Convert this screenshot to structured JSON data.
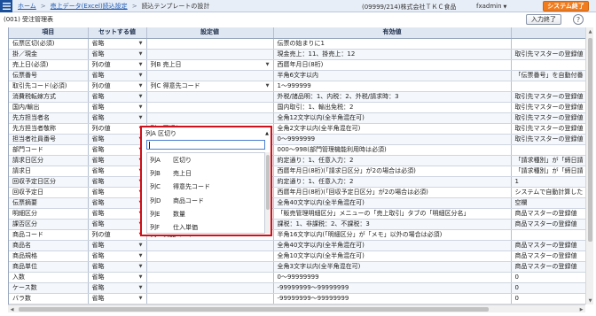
{
  "topbar": {
    "breadcrumbs": [
      "ホーム",
      "売上データ(Excel)読込設定",
      "読込テンプレートの設計"
    ],
    "company": "(09999/214)株式会社ＴＫＣ食品",
    "user": "fxadmin",
    "exit_label": "システム終了",
    "accent_color": "#f07c1e"
  },
  "subbar": {
    "screen_id": "(001) 受注管理表",
    "end_input_label": "入力終了",
    "help_label": "?"
  },
  "table": {
    "headers": [
      "項目",
      "セットする値",
      "設定値",
      "有効値",
      ""
    ],
    "rows": [
      {
        "item": "伝票区切(必須)",
        "set": "省略",
        "setting": "",
        "valid": "伝票の始まりに1",
        "extra": ""
      },
      {
        "item": "掛／現金",
        "set": "省略",
        "setting": "",
        "valid": "現金売上：11、掛売上：12",
        "extra": "取引先マスターの登録値"
      },
      {
        "item": "売上日(必須)",
        "set": "列の値",
        "setting": "列B 売上日",
        "valid": "西暦年月日(8桁)",
        "extra": ""
      },
      {
        "item": "伝票番号",
        "set": "省略",
        "setting": "",
        "valid": "半角6文字以内",
        "extra": "「伝票番号」を自動付番"
      },
      {
        "item": "取引先コード(必須)",
        "set": "列の値",
        "setting": "列C 得意先コード",
        "valid": "1～999999",
        "extra": ""
      },
      {
        "item": "消費税転嫁方式",
        "set": "省略",
        "setting": "",
        "valid": "外税/諸品明：1、内税：2、外税/請求時：3",
        "extra": "取引先マスターの登録値"
      },
      {
        "item": "国内/輸出",
        "set": "省略",
        "setting": "",
        "valid": "国内取引：1、輸出免税：2",
        "extra": "取引先マスターの登録値"
      },
      {
        "item": "先方担当者名",
        "set": "省略",
        "setting": "",
        "valid": "全角12文字以内(全半角混在可)",
        "extra": "取引先マスターの登録値"
      },
      {
        "item": "先方担当者敬称",
        "set": "列の値",
        "setting": "列A 区切り",
        "valid": "全角2文字以内(全半角混在可)",
        "extra": "取引先マスターの登録値"
      },
      {
        "item": "担当者社員番号",
        "set": "省略",
        "setting": "",
        "valid": "0～9999999",
        "extra": "取引先マスターの登録値"
      },
      {
        "item": "部門コード",
        "set": "省略",
        "setting": "",
        "valid": "000～998(部門管理機能利用時は必須)",
        "extra": ""
      },
      {
        "item": "請求日区分",
        "set": "省略",
        "setting": "",
        "valid": "約定通り：1、任意入力：2",
        "extra": "「請求種別」が「締日請"
      },
      {
        "item": "請求日",
        "set": "省略",
        "setting": "",
        "valid": "西暦年月日(8桁)(「請求日区分」が2の場合は必須)",
        "extra": "「請求種別」が「締日請"
      },
      {
        "item": "回収予定日区分",
        "set": "省略",
        "setting": "",
        "valid": "約定通り：1、任意入力：2",
        "extra": "1"
      },
      {
        "item": "回収予定日",
        "set": "省略",
        "setting": "",
        "valid": "西暦年月日(8桁)(「回収予定日区分」が2の場合は必須)",
        "extra": "システムで自動計算した"
      },
      {
        "item": "伝票摘要",
        "set": "省略",
        "setting": "",
        "valid": "全角40文字以内(全半角混在可)",
        "extra": "空欄"
      },
      {
        "item": "明細区分",
        "set": "省略",
        "setting": "",
        "valid": "「販売管理明細区分」メニューの「売上取引」タブの「明細区分名」",
        "extra": "商品マスターの登録値"
      },
      {
        "item": "課否区分",
        "set": "省略",
        "setting": "",
        "valid": "課税：1、非課税：2、不課税：3",
        "extra": "商品マスターの登録値"
      },
      {
        "item": "商品コード",
        "set": "列の値",
        "setting": "列D 商品コード",
        "valid": "半角16文字以内(「明細区分」が「メモ」以外の場合は必須)",
        "extra": ""
      },
      {
        "item": "商品名",
        "set": "省略",
        "setting": "",
        "valid": "全角40文字以内(全半角混在可)",
        "extra": "商品マスターの登録値"
      },
      {
        "item": "商品規格",
        "set": "省略",
        "setting": "",
        "valid": "全角10文字以内(全半角混在可)",
        "extra": "商品マスターの登録値"
      },
      {
        "item": "商品単位",
        "set": "省略",
        "setting": "",
        "valid": "全角3文字以内(全半角混在可)",
        "extra": "商品マスターの登録値"
      },
      {
        "item": "入数",
        "set": "省略",
        "setting": "",
        "valid": "0～99999999",
        "extra": "0"
      },
      {
        "item": "ケース数",
        "set": "省略",
        "setting": "",
        "valid": "-99999999～99999999",
        "extra": "0"
      },
      {
        "item": "バラ数",
        "set": "省略",
        "setting": "",
        "valid": "-99999999～99999999",
        "extra": "0"
      }
    ]
  },
  "dropdown": {
    "selected": "列A 区切り",
    "search_value": "",
    "options": [
      {
        "key": "列A",
        "label": "区切り"
      },
      {
        "key": "列B",
        "label": "売上日"
      },
      {
        "key": "列C",
        "label": "得意先コード"
      },
      {
        "key": "列D",
        "label": "商品コード"
      },
      {
        "key": "列E",
        "label": "数量"
      },
      {
        "key": "列F",
        "label": "仕入単価"
      }
    ]
  }
}
